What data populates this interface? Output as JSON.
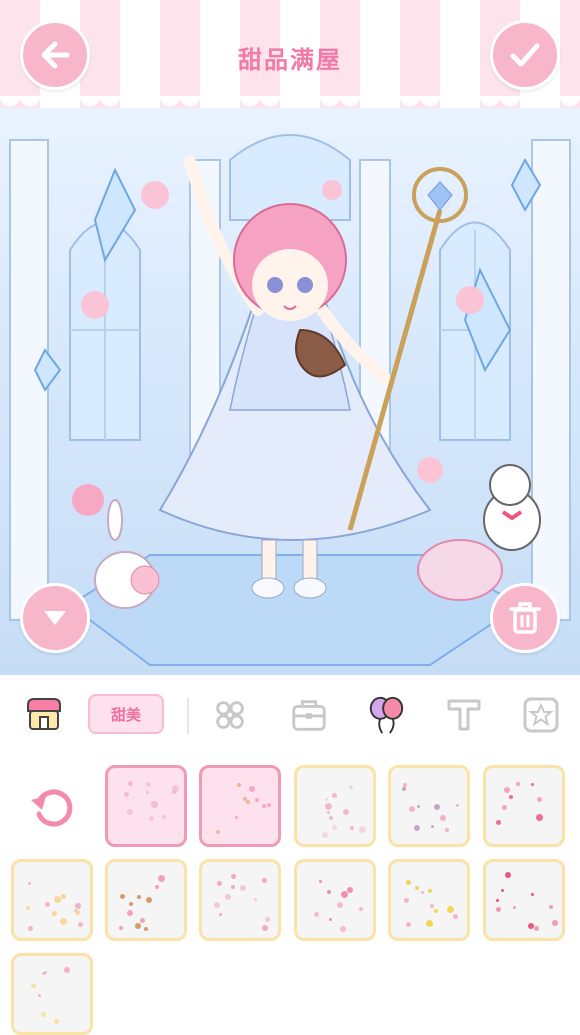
{
  "header": {
    "title": "甜品满屋"
  },
  "toolbar": {
    "active_tab_label": "甜美"
  },
  "colors": {
    "accent_pink": "#f8b6cb",
    "title_pink": "#f17aa6",
    "tile_border": "#fbe3a6",
    "tile_selected": "#f19ab8"
  },
  "icons": {
    "back": "arrow-left-icon",
    "confirm": "check-icon",
    "collapse": "chevron-down-icon",
    "delete": "trash-icon",
    "reset": "refresh-icon",
    "shop": "shop-icon",
    "flower": "flower-icon",
    "bag": "bag-icon",
    "balloon": "balloon-icon",
    "text": "text-icon",
    "star": "star-icon"
  },
  "grid": {
    "selected_count": 2,
    "tiles": [
      "decor-1",
      "decor-2",
      "decor-3",
      "decor-4",
      "decor-5",
      "decor-6",
      "decor-7",
      "decor-8",
      "decor-9",
      "decor-10",
      "decor-11",
      "decor-12",
      "decor-13"
    ]
  }
}
